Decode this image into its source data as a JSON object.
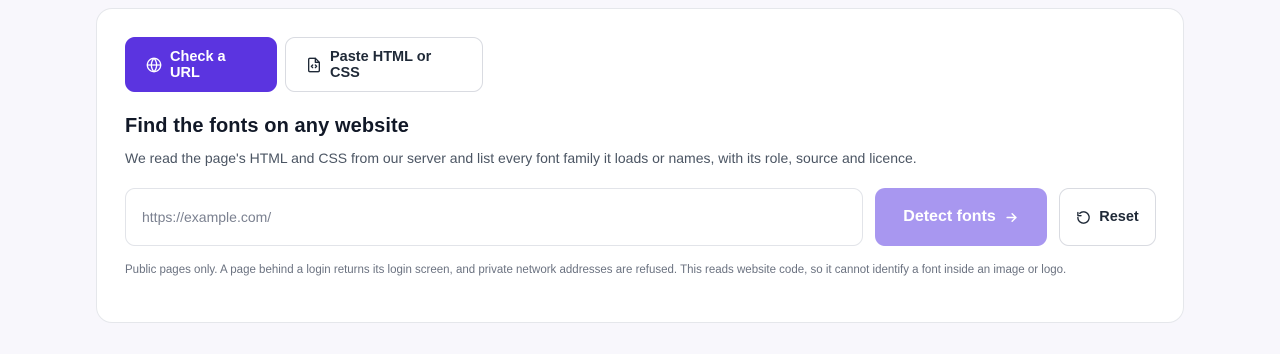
{
  "tabs": [
    {
      "label": "Check a URL",
      "icon": "globe-icon",
      "active": true
    },
    {
      "label": "Paste HTML or CSS",
      "icon": "code-file-icon",
      "active": false
    }
  ],
  "heading": "Find the fonts on any website",
  "description": "We read the page's HTML and CSS from our server and list every font family it loads or names, with its role, source and licence.",
  "url_input": {
    "value": "",
    "placeholder": "https://example.com/"
  },
  "detect_button": {
    "label": "Detect fonts",
    "icon": "arrow-right-icon"
  },
  "reset_button": {
    "label": "Reset",
    "icon": "rotate-ccw-icon"
  },
  "note": "Public pages only. A page behind a login returns its login screen, and private network addresses are refused. This reads website code, so it cannot identify a font inside an image or logo.",
  "colors": {
    "accent": "#5b34e0",
    "accent_disabled": "#a897f0",
    "page_background": "#f8f7fc"
  }
}
